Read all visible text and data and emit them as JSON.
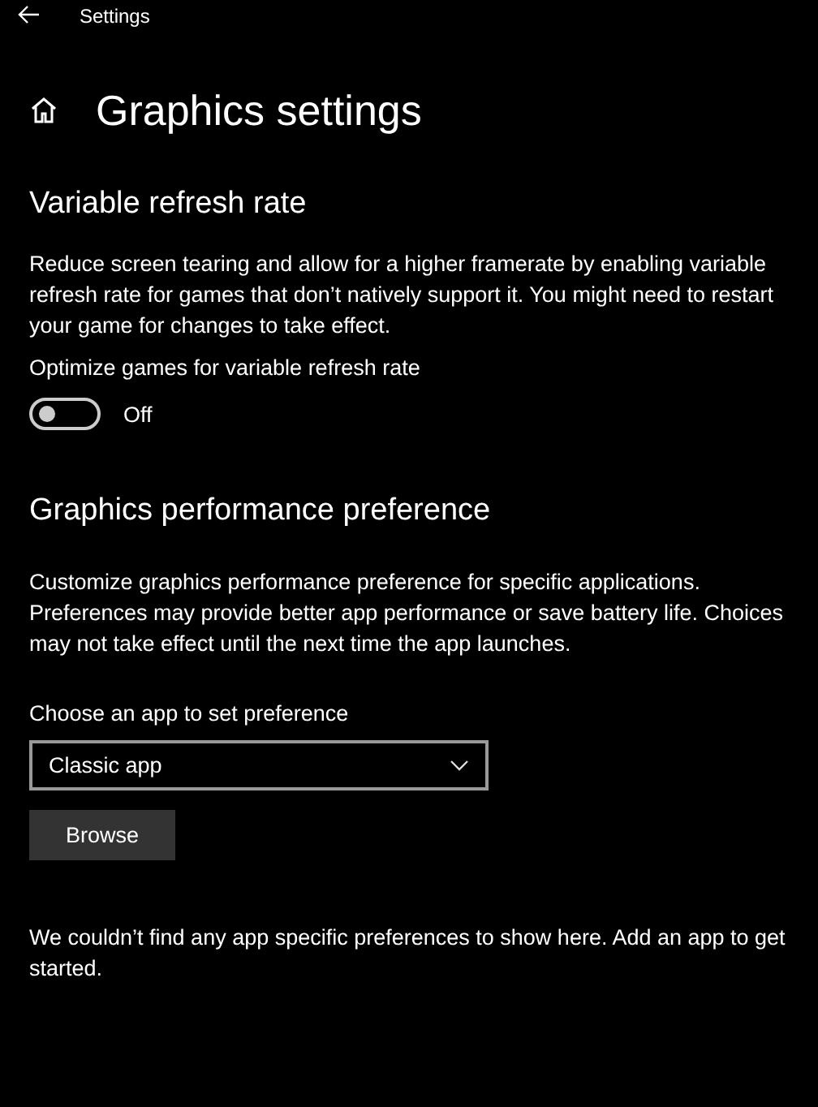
{
  "window": {
    "title": "Settings"
  },
  "page_title": "Graphics settings",
  "vrr": {
    "title": "Variable refresh rate",
    "description": "Reduce screen tearing and allow for a higher framerate by enabling variable refresh rate for games that don’t natively support it. You might need to restart your game for changes to take effect.",
    "toggle_label": "Optimize games for variable refresh rate",
    "toggle": {
      "on": false,
      "state_text": "Off"
    }
  },
  "preference": {
    "title": "Graphics performance preference",
    "description": "Customize graphics performance preference for specific applications. Preferences may provide better app performance or save battery life. Choices may not take effect until the next time the app launches.",
    "choose_label": "Choose an app to set preference",
    "dropdown": {
      "value": "Classic app"
    },
    "browse_button": "Browse",
    "empty_message": "We couldn’t find any app specific preferences to show here. Add an app to get started."
  }
}
